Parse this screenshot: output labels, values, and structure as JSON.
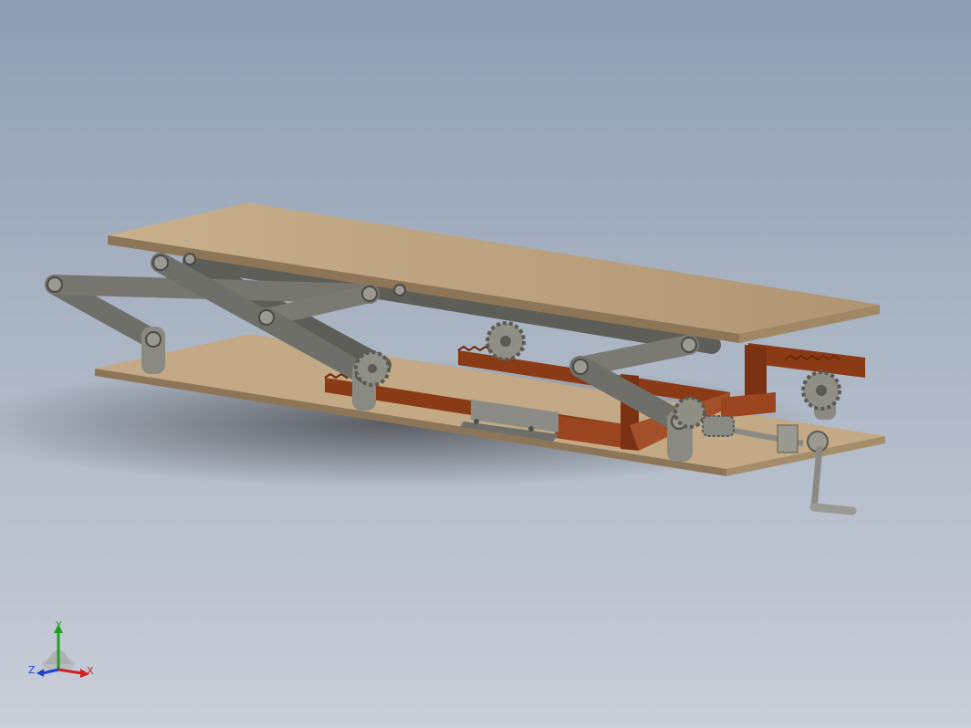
{
  "colors": {
    "background_top": "#8e9eb3",
    "background_bottom": "#c9ced8",
    "plate": "#b9a07e",
    "plate_edge": "#8d7658",
    "link": "#6f6f69",
    "link_light": "#8c8c84",
    "rack": "#8a3a15",
    "rack_light": "#a9562b",
    "gear": "#8f8f86",
    "axis_x": "#d02020",
    "axis_y": "#20a020",
    "axis_z": "#2040d0"
  },
  "triad": {
    "x_label": "X",
    "y_label": "Y",
    "z_label": "Z"
  }
}
